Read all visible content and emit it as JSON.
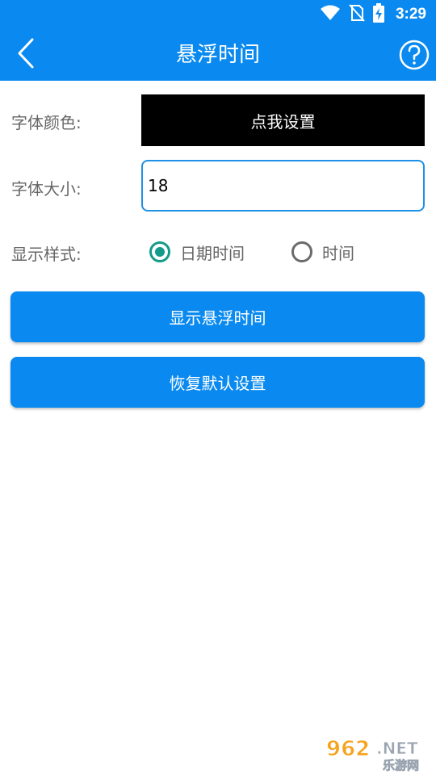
{
  "status_bar": {
    "time": "3:29",
    "icons": [
      "wifi-icon",
      "no-sim-icon",
      "battery-charging-icon"
    ]
  },
  "toolbar": {
    "back_icon": "chevron-left-icon",
    "title": "悬浮时间",
    "help_icon": "question-circle-icon"
  },
  "form": {
    "font_color": {
      "label": "字体颜色:",
      "button_label": "点我设置",
      "button_color": "#000000"
    },
    "font_size": {
      "label": "字体大小:",
      "value": "18"
    },
    "display_style": {
      "label": "显示样式:",
      "options": [
        {
          "label": "日期时间",
          "checked": true
        },
        {
          "label": "时间",
          "checked": false
        }
      ]
    }
  },
  "actions": {
    "show_button": "显示悬浮时间",
    "reset_button": "恢复默认设置"
  },
  "colors": {
    "accent": "#0a8af0",
    "radio_checked": "#129a8a"
  },
  "watermark": {
    "top": "962.NET",
    "bottom": "乐游网"
  }
}
